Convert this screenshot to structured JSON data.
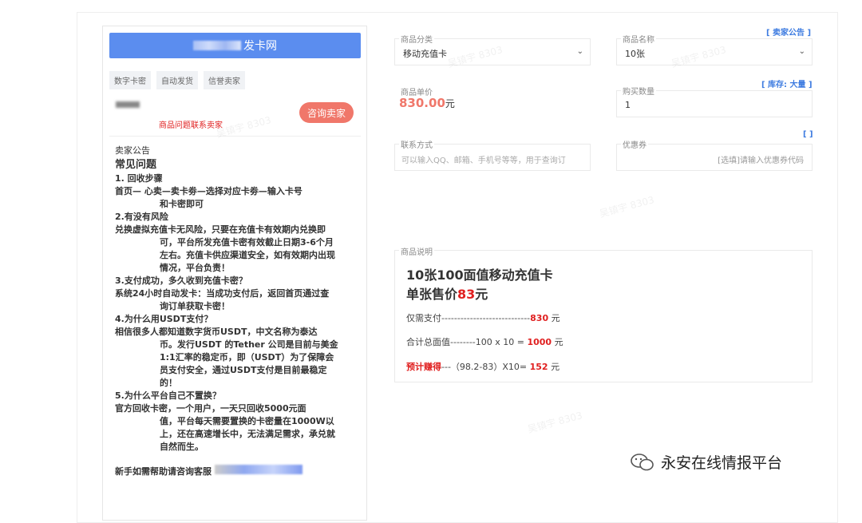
{
  "site": {
    "title_suffix": "发卡网",
    "tags": [
      "数字卡密",
      "自动发货",
      "信誉卖家"
    ],
    "problem_link": "商品问题联系卖家",
    "consult_button": "咨询卖家"
  },
  "notice": {
    "heading": "卖家公告",
    "title": "常见问题",
    "q1": "1.    回收步骤",
    "a1a": "  首页—  心卖—卖卡劵—选择对应卡劵—输入卡号",
    "a1b": "和卡密即可",
    "q2": "2.有没有风险",
    "a2a": "兑换虚拟充值卡无风险，只要在充值卡有效期内兑换即",
    "a2b": "可，平台所发充值卡密有效截止日期3-6个月",
    "a2c": "左右。充值卡供应渠道安全，如有效期内出现",
    "a2d": "情况，平台负责！",
    "q3": "3.支付成功，多久收到充值卡密？",
    "a3a": "系统24小时自动发卡：当成功支付后，返回首页通过查",
    "a3b": "询订单获取卡密！",
    "q4": "4.为什么用USDT支付？",
    "a4a": "相信很多人都知道数字货币USDT，中文名称为泰达",
    "a4b": "币。发行USDT 的Tether 公司是目前与美金",
    "a4c": "1:1汇率的稳定币，即（USDT）为了保障会",
    "a4d": "员支付安全，通过USDT支付是目前最稳定",
    "a4e": "的！",
    "q5": "5.为什么平台自己不置换？",
    "a5a": "  官方回收卡密，一个用户，一天只回收5000元面",
    "a5b": "值，平台每天需要置换的卡密量在1000W以",
    "a5c": "上，还在高速增长中，无法满足需求，承兑就",
    "a5d": "自然而生。",
    "help": "新手如需帮助请咨询客服"
  },
  "form": {
    "category_label": "商品分类",
    "category_value": "移动充值卡",
    "name_label": "商品名称",
    "name_value": "10张",
    "seller_notice_link": "[ 卖家公告 ]",
    "price_label": "商品单价",
    "price_value": "830.00",
    "price_unit": "元",
    "stock_link": "[ 库存: 大量 ]",
    "qty_label": "购买数量",
    "qty_value": "1",
    "contact_label": "联系方式",
    "contact_placeholder": "可以输入QQ、邮箱、手机号等等，用于查询订",
    "coupon_link": "[ ]",
    "coupon_label": "优惠券",
    "coupon_placeholder": "[选填]请输入优惠券代码"
  },
  "description": {
    "label": "商品说明",
    "title1": "10张100面值移动充值卡",
    "title2_a": "单张售价",
    "title2_b": "83",
    "title2_c": "元",
    "line1_a": "仅需支付----------------------------",
    "line1_b": "830",
    "line1_c": " 元",
    "line2_a": "合计总面值--------100 x 10 = ",
    "line2_b": "1000",
    "line2_c": " 元",
    "line3_a": "预计赚得",
    "line3_b": "---（98.2-83）X10= ",
    "line3_c": "152",
    "line3_d": " 元"
  },
  "watermark": "吴镇宇 8303",
  "brand": {
    "name": "永安在线情报平台"
  }
}
